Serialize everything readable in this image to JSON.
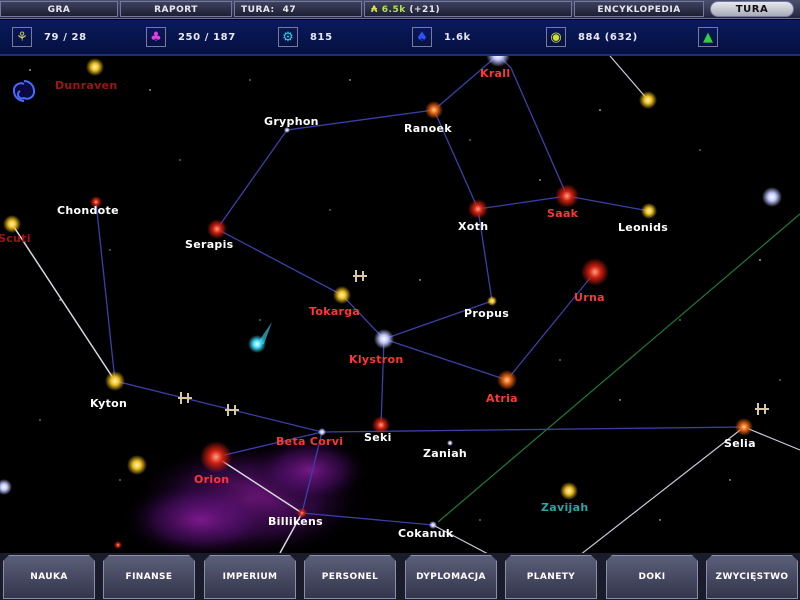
{
  "top_menu": {
    "game": "GRA",
    "report": "RAPORT",
    "turn_label": "TURA:",
    "turn_value": "47",
    "money_value": "6.5k",
    "money_delta": "(+21)",
    "encyclopedia": "ENCYKLOPEDIA",
    "turn_button": "TURA"
  },
  "resources": [
    {
      "icon": "food-icon",
      "glyph": "⚘",
      "color": "#e0d060",
      "value": "79 / 28"
    },
    {
      "icon": "industry-icon",
      "glyph": "♣",
      "color": "#e040e0",
      "value": "250 / 187"
    },
    {
      "icon": "research-icon",
      "glyph": "⚙",
      "color": "#30d0e0",
      "value": "815"
    },
    {
      "icon": "population-icon",
      "glyph": "♠",
      "color": "#3050ff",
      "value": "1.6k"
    },
    {
      "icon": "influence-icon",
      "glyph": "◉",
      "color": "#d0e030",
      "value": "884 (632)"
    },
    {
      "icon": "approval-icon",
      "glyph": "▲",
      "color": "#30d040",
      "value": ""
    }
  ],
  "systems": [
    {
      "name": "Dunraven",
      "owner": "dark"
    },
    {
      "name": "Krall",
      "owner": "red"
    },
    {
      "name": "Gryphon",
      "owner": "white"
    },
    {
      "name": "Ranoek",
      "owner": "white"
    },
    {
      "name": "Chondote",
      "owner": "white"
    },
    {
      "name": "Scuti",
      "owner": "dark"
    },
    {
      "name": "Serapis",
      "owner": "white"
    },
    {
      "name": "Xoth",
      "owner": "white"
    },
    {
      "name": "Saak",
      "owner": "red"
    },
    {
      "name": "Leonids",
      "owner": "white"
    },
    {
      "name": "Tokarga",
      "owner": "red"
    },
    {
      "name": "Propus",
      "owner": "white"
    },
    {
      "name": "Urna",
      "owner": "red"
    },
    {
      "name": "Klystron",
      "owner": "red"
    },
    {
      "name": "Kyton",
      "owner": "white"
    },
    {
      "name": "Atria",
      "owner": "red"
    },
    {
      "name": "Beta Corvi",
      "owner": "red"
    },
    {
      "name": "Seki",
      "owner": "white"
    },
    {
      "name": "Zaniah",
      "owner": "white"
    },
    {
      "name": "Selia",
      "owner": "white"
    },
    {
      "name": "Orion",
      "owner": "red"
    },
    {
      "name": "Zavijah",
      "owner": "teal"
    },
    {
      "name": "Billikens",
      "owner": "white"
    },
    {
      "name": "Cokanuk",
      "owner": "white"
    }
  ],
  "bottom_menu": [
    "NAUKA",
    "FINANSE",
    "IMPERIUM",
    "PERSONEL",
    "DYPLOMACJA",
    "PLANETY",
    "DOKI",
    "ZWYCIĘSTWO"
  ]
}
